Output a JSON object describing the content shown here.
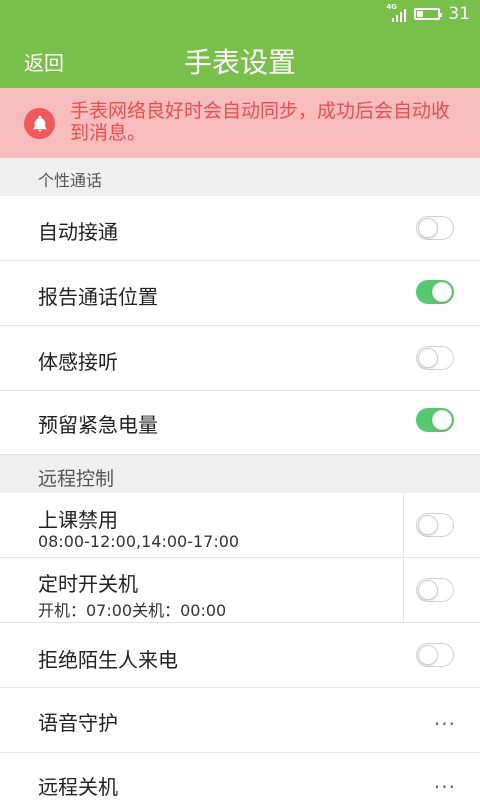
{
  "status_bar": {
    "network_label": "4G",
    "battery_level_percent": 31,
    "battery_text": "31"
  },
  "header": {
    "back_label": "返回",
    "title": "手表设置"
  },
  "notice": {
    "text": "手表网络良好时会自动同步，成功后会自动收到消息。",
    "icon": "bell-icon",
    "color": "#ea4f4f"
  },
  "sections": {
    "personal_call": {
      "title": "个性通话",
      "items": [
        {
          "label": "自动接通",
          "enabled": false
        },
        {
          "label": "报告通话位置",
          "enabled": true
        },
        {
          "label": "体感接听",
          "enabled": false
        },
        {
          "label": "预留紧急电量",
          "enabled": true
        }
      ]
    },
    "remote_control": {
      "title": "远程控制",
      "items": [
        {
          "label": "上课禁用",
          "subtitle": "08:00-12:00,14:00-17:00",
          "enabled": false
        },
        {
          "label": "定时开关机",
          "subtitle": "开机：07:00关机：00:00",
          "enabled": false
        },
        {
          "label": "拒绝陌生人来电",
          "enabled": false
        },
        {
          "label": "语音守护",
          "action": "..."
        },
        {
          "label": "远程关机",
          "action": "..."
        }
      ]
    }
  },
  "colors": {
    "header_green": "#78c04a",
    "notice_pink": "#f7bcbc",
    "toggle_on": "#55c96d",
    "toggle_off": "#ffffff"
  }
}
